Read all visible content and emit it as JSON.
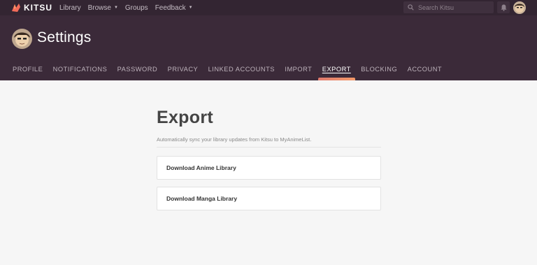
{
  "app": {
    "name": "KITSU"
  },
  "topnav": {
    "links": [
      {
        "label": "Library",
        "dropdown": false
      },
      {
        "label": "Browse",
        "dropdown": true
      },
      {
        "label": "Groups",
        "dropdown": false
      },
      {
        "label": "Feedback",
        "dropdown": true
      }
    ],
    "search_placeholder": "Search Kitsu"
  },
  "header": {
    "title": "Settings",
    "tabs": [
      {
        "label": "PROFILE",
        "active": false
      },
      {
        "label": "NOTIFICATIONS",
        "active": false
      },
      {
        "label": "PASSWORD",
        "active": false
      },
      {
        "label": "PRIVACY",
        "active": false
      },
      {
        "label": "LINKED ACCOUNTS",
        "active": false
      },
      {
        "label": "IMPORT",
        "active": false
      },
      {
        "label": "EXPORT",
        "active": true
      },
      {
        "label": "BLOCKING",
        "active": false
      },
      {
        "label": "ACCOUNT",
        "active": false
      }
    ]
  },
  "main": {
    "title": "Export",
    "description": "Automatically sync your library updates from Kitsu to MyAnimeList.",
    "actions": [
      {
        "label": "Download Anime Library"
      },
      {
        "label": "Download Manga Library"
      }
    ]
  },
  "colors": {
    "topbar": "#332532",
    "header": "#3b2a39",
    "accent": "#e9806c",
    "background": "#f6f6f6"
  }
}
